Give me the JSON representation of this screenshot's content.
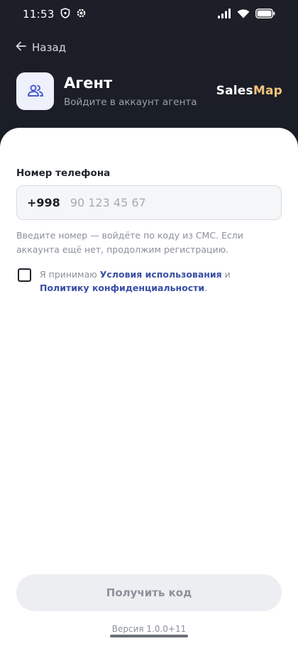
{
  "status_bar": {
    "time": "11:53",
    "icons": [
      "shield-icon",
      "gear-icon",
      "signal-icon",
      "wifi-icon",
      "battery-icon"
    ]
  },
  "nav": {
    "back_label": "Назад"
  },
  "header": {
    "title": "Агент",
    "subtitle": "Войдите в аккаунт агента",
    "brand_part1": "Sales",
    "brand_part2": "Map",
    "brand_accent_color": "#f3c37a",
    "icon": "users-icon"
  },
  "form": {
    "phone_label": "Номер телефона",
    "phone_prefix": "+998",
    "phone_value": "",
    "phone_placeholder": "90 123 45 67",
    "hint": "Введите номер — войдёте по коду из СМС. Если аккаунта ещё нет, продолжим регистрацию.",
    "consent": {
      "checked": false,
      "text_before": "Я принимаю ",
      "terms_link": "Условия использования",
      "text_between": " и ",
      "privacy_link": "Политику конфиденциальности",
      "text_after": "."
    },
    "submit_label": "Получить код"
  },
  "footer": {
    "version": "Версия 1.0.0+11"
  },
  "colors": {
    "link": "#3a4fa5",
    "dark_bg": "#1c1f27"
  }
}
